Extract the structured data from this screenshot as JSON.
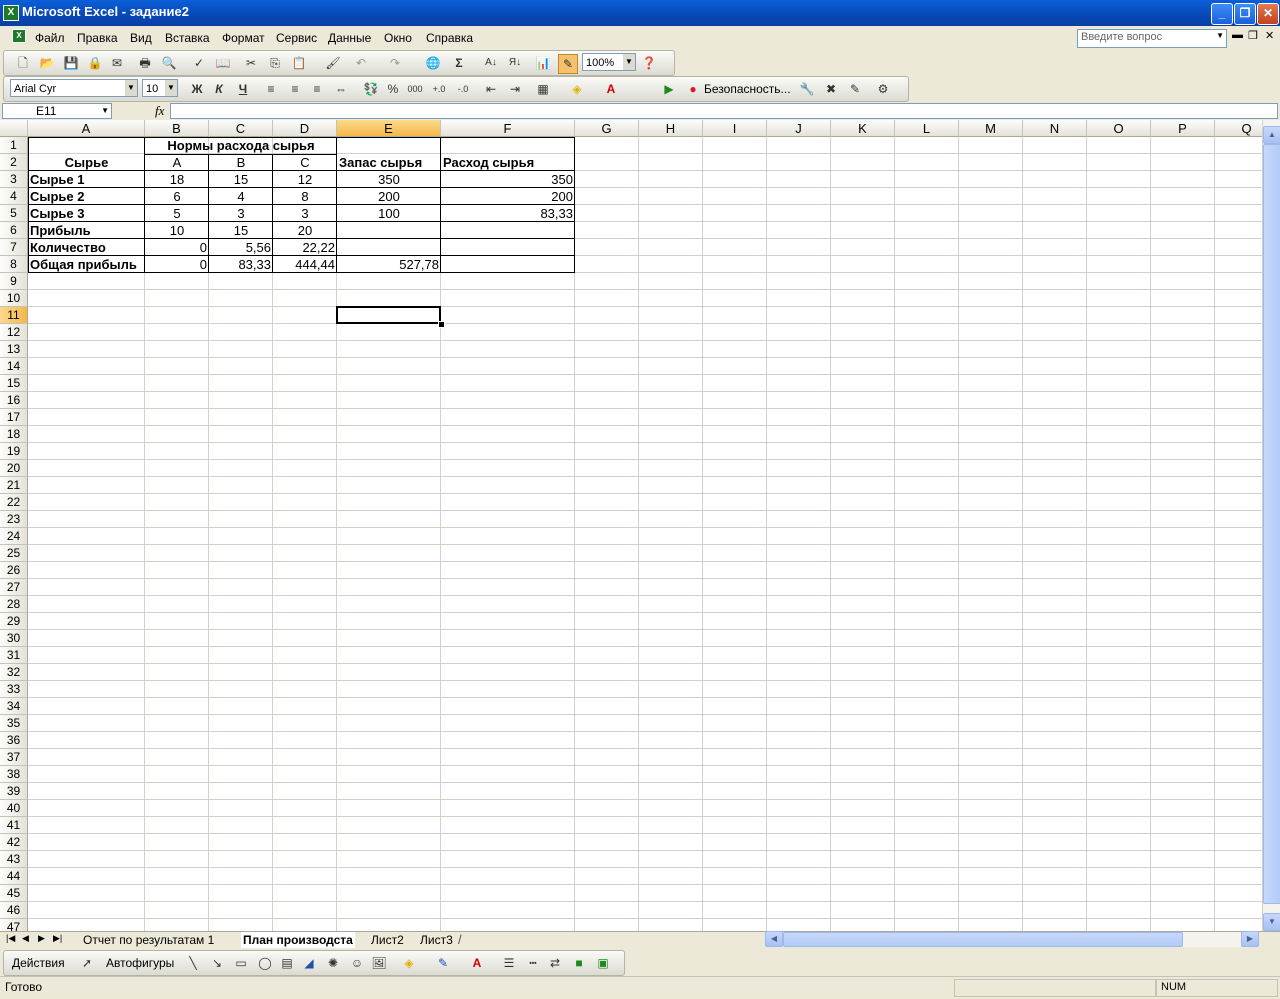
{
  "window": {
    "title": "Microsoft Excel - задание2"
  },
  "menu": {
    "items": [
      "Файл",
      "Правка",
      "Вид",
      "Вставка",
      "Формат",
      "Сервис",
      "Данные",
      "Окно",
      "Справка"
    ],
    "help_placeholder": "Введите вопрос"
  },
  "toolbar": {
    "zoom": "100%",
    "font": "Arial Cyr",
    "font_size": "10",
    "bold": "Ж",
    "italic": "К",
    "underline": "Ч",
    "security": "Безопасность...",
    "sigma": "Σ",
    "percent": "%",
    "thousands": "000"
  },
  "formula_bar": {
    "name_box": "E11",
    "fx": "fx",
    "content": ""
  },
  "grid": {
    "columns": [
      "A",
      "B",
      "C",
      "D",
      "E",
      "F",
      "G",
      "H",
      "I",
      "J",
      "K",
      "L",
      "M",
      "N",
      "O",
      "P",
      "Q"
    ],
    "selected_column": "E",
    "selected_row": "11",
    "visible_rows": 47
  },
  "cells": {
    "B1": "Нормы расхода сырья",
    "A2": "Сырье",
    "B2": "A",
    "C2": "B",
    "D2": "C",
    "E2": "Запас сырья",
    "F2": "Расход сырья",
    "A3": "Сырье 1",
    "B3": "18",
    "C3": "15",
    "D3": "12",
    "E3": "350",
    "F3": "350",
    "A4": "Сырье 2",
    "B4": "6",
    "C4": "4",
    "D4": "8",
    "E4": "200",
    "F4": "200",
    "A5": "Сырье 3",
    "B5": "5",
    "C5": "3",
    "D5": "3",
    "E5": "100",
    "F5": "83,33",
    "A6": "Прибыль",
    "B6": "10",
    "C6": "15",
    "D6": "20",
    "A7": "Количество",
    "B7": "0",
    "C7": "5,56",
    "D7": "22,22",
    "A8": "Общая прибыль",
    "B8": "0",
    "C8": "83,33",
    "D8": "444,44",
    "E8": "527,78"
  },
  "sheet_tabs": {
    "tabs": [
      "Отчет по результатам 1",
      "План производства",
      "Лист2",
      "Лист3"
    ],
    "active": "План производства",
    "active_display": "План производста"
  },
  "drawing_toolbar": {
    "actions": "Действия",
    "autoshapes": "Автофигуры"
  },
  "status": {
    "ready": "Готово",
    "num": "NUM"
  },
  "colors": {
    "title_bar": "#0a5fd8",
    "selection_header": "#f5b84a"
  }
}
